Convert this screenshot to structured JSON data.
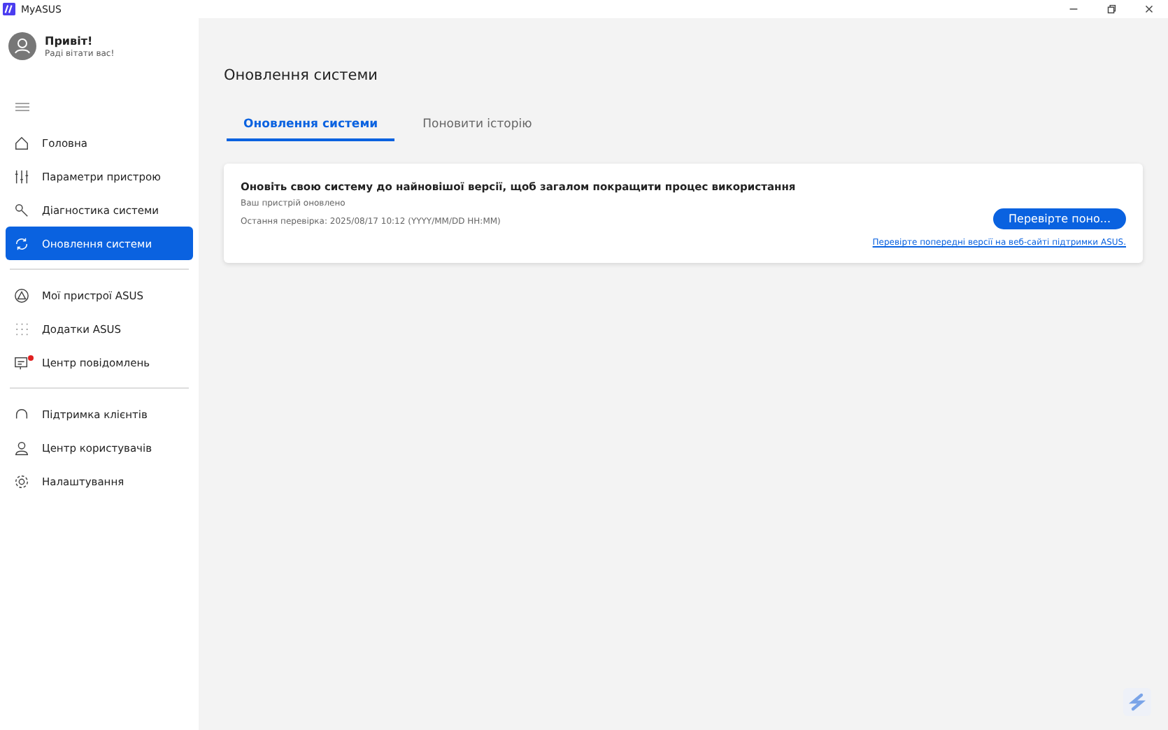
{
  "window": {
    "title": "MyASUS"
  },
  "profile": {
    "greeting": "Привіт!",
    "subtitle": "Раді вітати вас!"
  },
  "sidebar": {
    "groups": [
      [
        {
          "label": "Головна",
          "selected": false,
          "badge": false
        },
        {
          "label": "Параметри пристрою",
          "selected": false,
          "badge": false
        },
        {
          "label": "Діагностика системи",
          "selected": false,
          "badge": false
        },
        {
          "label": "Оновлення системи",
          "selected": true,
          "badge": false
        }
      ],
      [
        {
          "label": "Мої пристрої ASUS",
          "selected": false,
          "badge": false
        },
        {
          "label": "Додатки ASUS",
          "selected": false,
          "badge": false
        },
        {
          "label": "Центр повідомлень",
          "selected": false,
          "badge": true
        }
      ],
      [
        {
          "label": "Підтримка клієнтів",
          "selected": false,
          "badge": false
        },
        {
          "label": "Центр користувачів",
          "selected": false,
          "badge": false
        },
        {
          "label": "Налаштування",
          "selected": false,
          "badge": false
        }
      ]
    ]
  },
  "page_title": "Оновлення системи",
  "tabs": [
    {
      "label": "Оновлення системи",
      "selected": true
    },
    {
      "label": "Поновити історію",
      "selected": false
    }
  ],
  "card": {
    "heading": "Оновіть свою систему до найновішої версії, щоб загалом покращити процес використання",
    "status": "Ваш пристрій оновлено",
    "last_check": "Остання перевірка: 2025/08/17 10:12 (YYYY/MM/DD HH:MM)",
    "button": "Перевірте поно...",
    "link": "Перевірте попередні версії на веб-сайті підтримки ASUS."
  }
}
